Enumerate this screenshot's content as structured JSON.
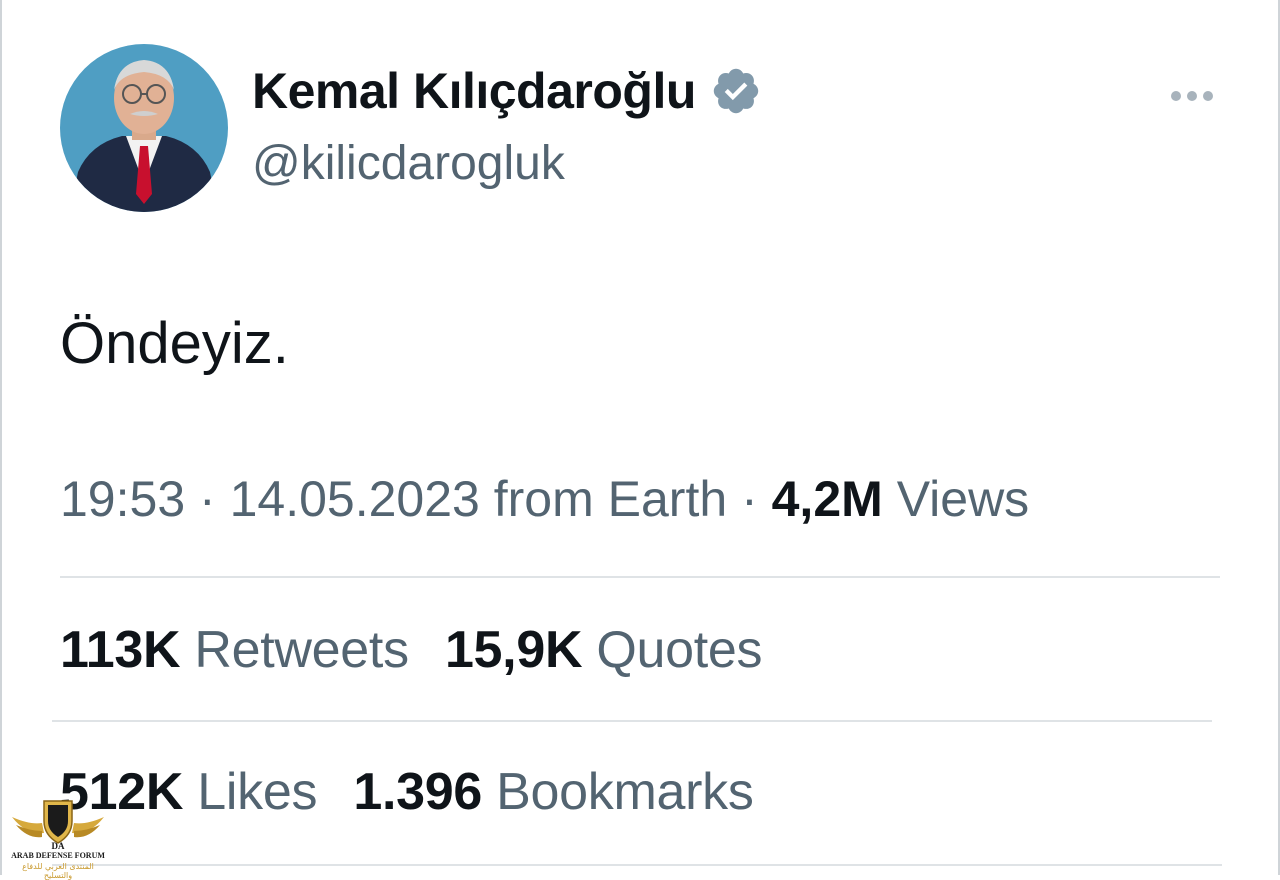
{
  "author": {
    "display_name": "Kemal Kılıçdaroğlu",
    "handle": "@kilicdarogluk",
    "verified": true,
    "avatar_icon": "profile-photo"
  },
  "tweet": {
    "text": "Öndeyiz."
  },
  "meta": {
    "time": "19:53",
    "separator": "·",
    "date": "14.05.2023",
    "source": "from Earth",
    "views_count": "4,2M",
    "views_label": "Views"
  },
  "stats": {
    "retweets": {
      "count": "113K",
      "label": "Retweets"
    },
    "quotes": {
      "count": "15,9K",
      "label": "Quotes"
    },
    "likes": {
      "count": "512K",
      "label": "Likes"
    },
    "bookmarks": {
      "count": "1.396",
      "label": "Bookmarks"
    }
  },
  "watermark": {
    "logo_text": "DA",
    "title": "ARAB DEFENSE FORUM",
    "subtitle": "المنتدى العربي للدفاع والتسليح"
  },
  "colors": {
    "text_primary": "#0f1419",
    "text_secondary": "#536471",
    "verified_badge": "#829aab",
    "divider": "#dfe3e6"
  },
  "icons": {
    "verified": "verified-badge-icon",
    "more": "more-options-icon"
  }
}
